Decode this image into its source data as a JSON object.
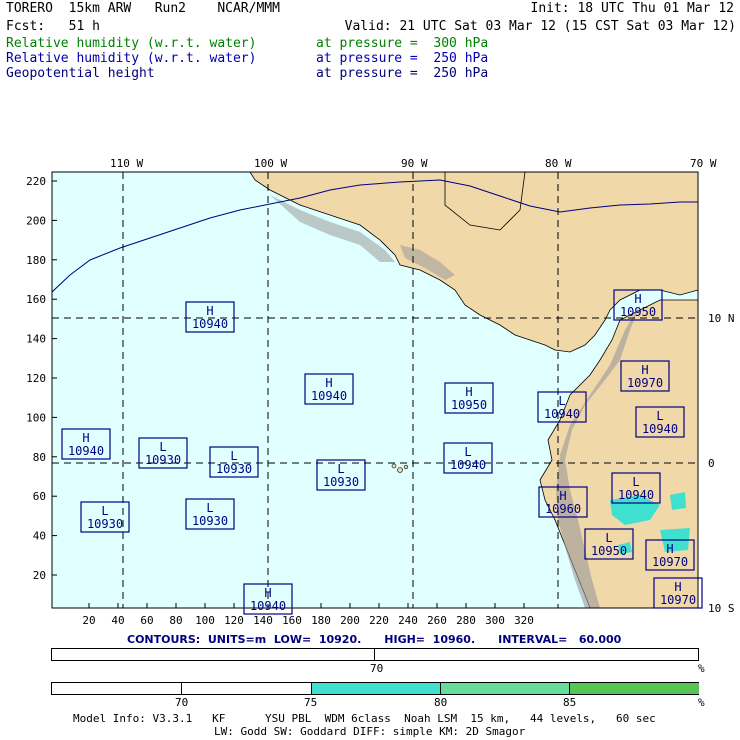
{
  "header": {
    "line1_left": "TORERO  15km ARW   Run2    NCAR/MMM",
    "line1_right": "Init: 18 UTC Thu 01 Mar 12",
    "line2_left": "Fcst:   51 h",
    "line2_right": "Valid: 21 UTC Sat 03 Mar 12 (15 CST Sat 03 Mar 12)",
    "fields": [
      {
        "name": "Relative humidity (w.r.t. water)",
        "level": "at pressure =  300 hPa",
        "color": "#008000"
      },
      {
        "name": "Relative humidity (w.r.t. water)",
        "level": "at pressure =  250 hPa",
        "color": "#0000b0"
      },
      {
        "name": "Geopotential height",
        "level": "at pressure =  250 hPa",
        "color": "#000080"
      }
    ]
  },
  "map": {
    "lon_labels": [
      "110 W",
      "100 W",
      "90 W",
      "80 W",
      "70 W"
    ],
    "lat_labels": [
      "10 N",
      "0",
      "10 S"
    ],
    "x_ticks": [
      "20",
      "40",
      "60",
      "80",
      "100",
      "120",
      "140",
      "160",
      "180",
      "200",
      "220",
      "240",
      "260",
      "280",
      "300",
      "320"
    ],
    "y_ticks": [
      "220",
      "200",
      "180",
      "160",
      "140",
      "120",
      "100",
      "80",
      "60",
      "40",
      "20"
    ],
    "colors": {
      "ocean": "#e0ffff",
      "land": "#f0d8a8",
      "terrain_dark": "#808080",
      "grid": "#000000",
      "rh": "#40e0d0",
      "contour": "#000080"
    },
    "centers": [
      {
        "type": "H",
        "value": "10940"
      },
      {
        "type": "H",
        "value": "10940"
      },
      {
        "type": "H",
        "value": "10940"
      },
      {
        "type": "H",
        "value": "10950"
      },
      {
        "type": "H",
        "value": "10950"
      },
      {
        "type": "H",
        "value": "10970"
      },
      {
        "type": "H",
        "value": "10960"
      },
      {
        "type": "H",
        "value": "10970"
      },
      {
        "type": "H",
        "value": "10970"
      },
      {
        "type": "H",
        "value": "10940"
      },
      {
        "type": "L",
        "value": "10930"
      },
      {
        "type": "L",
        "value": "10930"
      },
      {
        "type": "L",
        "value": "10930"
      },
      {
        "type": "L",
        "value": "10930"
      },
      {
        "type": "L",
        "value": "10930"
      },
      {
        "type": "L",
        "value": "10940"
      },
      {
        "type": "L",
        "value": "10940"
      },
      {
        "type": "L",
        "value": "10940"
      },
      {
        "type": "L",
        "value": "10940"
      },
      {
        "type": "L",
        "value": "10950"
      }
    ]
  },
  "contour_info": "CONTOURS:  UNITS=m  LOW=  10920.      HIGH=  10960.      INTERVAL=   60.000",
  "colorbar1": {
    "label": "70",
    "unit": "%"
  },
  "colorbar2": {
    "labels": [
      "70",
      "75",
      "80",
      "85"
    ],
    "unit": "%",
    "colors": [
      "#ffffff",
      "#40e0d0",
      "#66dd99",
      "#55c655"
    ]
  },
  "model_info_1": "Model Info: V3.3.1   KF      YSU PBL  WDM 6class  Noah LSM  15 km,   44 levels,   60 sec",
  "model_info_2": "LW: Godd SW: Goddard DIFF: simple KM: 2D Smagor"
}
